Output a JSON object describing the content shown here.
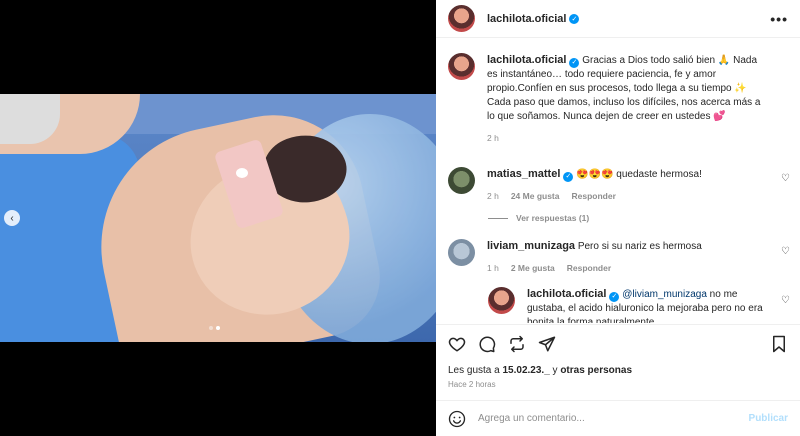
{
  "post": {
    "author": "lachilota.oficial",
    "more_label": "•••",
    "carousel_prev": "‹"
  },
  "caption": {
    "username": "lachilota.oficial",
    "text": "Gracias a Dios todo salió bien 🙏 Nada es instantáneo… todo requiere paciencia, fe y amor propio.Confíen en sus procesos, todo llega a su tiempo ✨ Cada paso que damos, incluso los difíciles, nos acerca más a lo que soñamos. Nunca dejen de creer en ustedes 💕",
    "time": "2 h"
  },
  "comments": [
    {
      "username": "matias_mattel",
      "text": "😍😍😍 quedaste hermosa!",
      "time": "2 h",
      "likes": "24 Me gusta",
      "reply": "Responder",
      "view_replies": "Ver respuestas (1)"
    },
    {
      "username": "liviam_munizaga",
      "text": "Pero si su nariz es hermosa",
      "time": "1 h",
      "likes": "2 Me gusta",
      "reply": "Responder"
    },
    {
      "username": "lachilota.oficial",
      "mention": "@liviam_munizaga",
      "text": "no me gustaba, el acido hialuronico la mejoraba pero no era bonita la forma naturalmente"
    }
  ],
  "likes": {
    "prefix": "Les gusta a ",
    "user": "15.02.23._",
    "middle": " y ",
    "others": "otras personas"
  },
  "posted_ago": "Hace 2 horas",
  "composer": {
    "placeholder": "Agrega un comentario...",
    "publish": "Publicar"
  },
  "colors": {
    "verified": "#0095f6",
    "publish_disabled": "#b2dffc"
  }
}
